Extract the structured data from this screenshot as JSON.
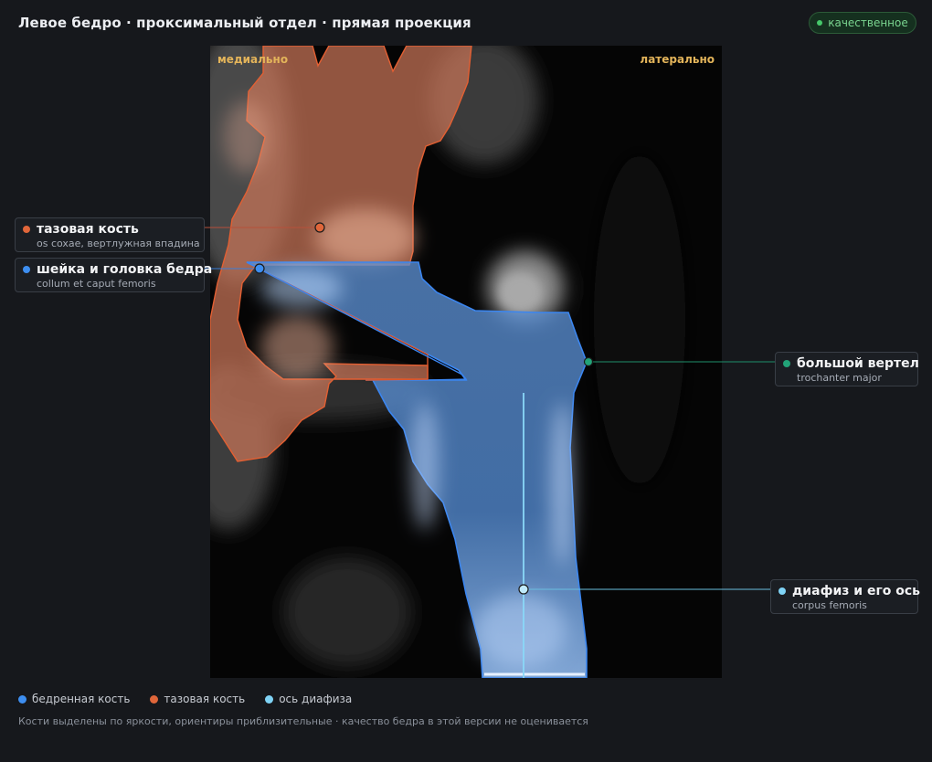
{
  "header": {
    "title": "Левое бедро · проксимальный отдел · прямая проекция",
    "status_badge": "качественное"
  },
  "viewer": {
    "orientation_left": "медиально",
    "orientation_right": "латерально"
  },
  "callouts": [
    {
      "id": "pelvis",
      "name": "тазовая кость",
      "latin": "os coxae, вертлужная впадина",
      "color": "#e0663a"
    },
    {
      "id": "neck",
      "name": "шейка и головка бедра",
      "latin": "collum et caput femoris",
      "color": "#3d8ef0"
    },
    {
      "id": "trochanter",
      "name": "большой вертел",
      "latin": "trochanter major",
      "color": "#22a378"
    },
    {
      "id": "shaft",
      "name": "диафиз и его ось",
      "latin": "corpus femoris",
      "color": "#7fd3f5"
    }
  ],
  "legend": [
    {
      "label": "бедренная кость",
      "color": "#3d8ef0"
    },
    {
      "label": "тазовая кость",
      "color": "#e0663a"
    },
    {
      "label": "ось диафиза",
      "color": "#7fd3f5"
    }
  ],
  "footnote": "Кости выделены по яркости, ориентиры приблизительные · качество бедра в этой версии не оценивается"
}
